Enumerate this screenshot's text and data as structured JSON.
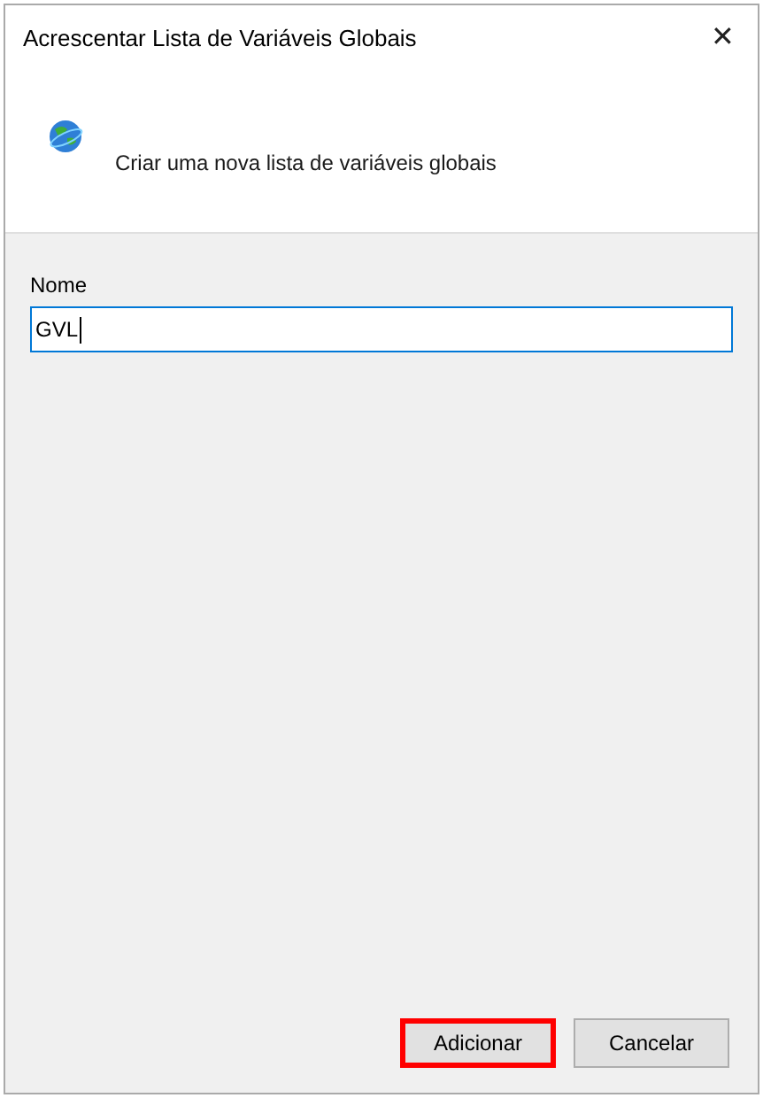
{
  "window": {
    "title": "Acrescentar Lista de Variáveis Globais",
    "close": "✕"
  },
  "header": {
    "description": "Criar uma nova lista de variáveis globais"
  },
  "form": {
    "label": "Nome",
    "value": "GVL",
    "focused": true
  },
  "buttons": [
    {
      "label": "Adicionar",
      "highlighted": true
    },
    {
      "label": "Cancelar",
      "highlighted": false
    }
  ]
}
